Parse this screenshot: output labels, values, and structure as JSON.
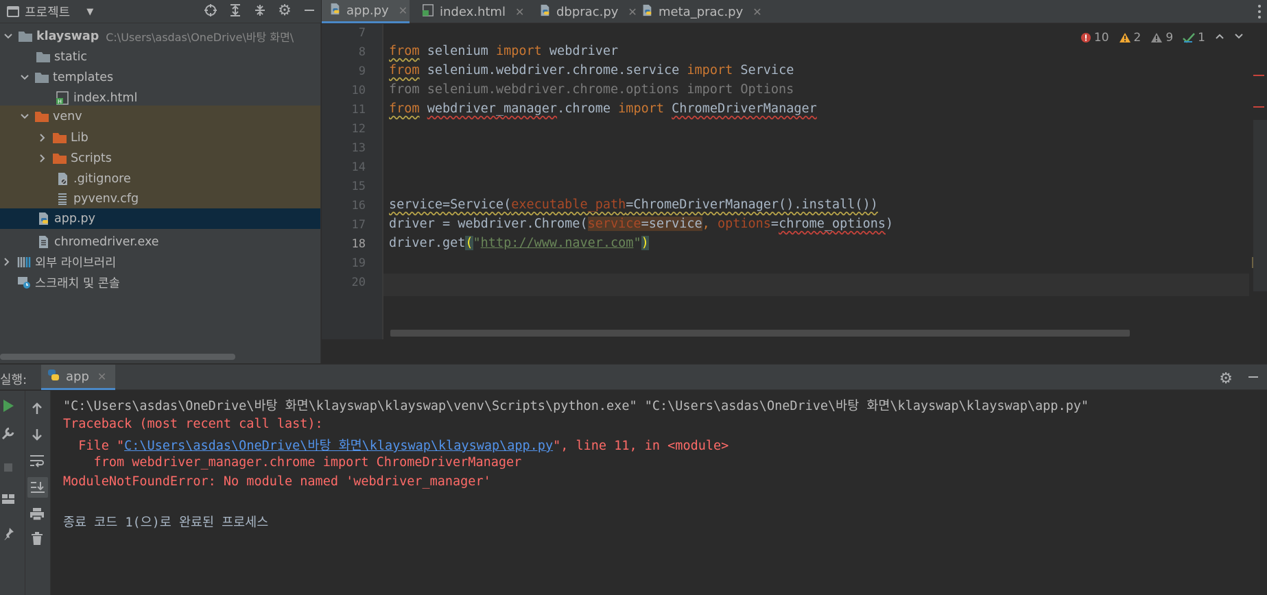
{
  "project_panel": {
    "title": "프로젝트",
    "tree": [
      {
        "label": "klayswap",
        "hint": "C:\\Users\\asdas\\OneDrive\\바탕 화면\\"
      },
      {
        "label": "static"
      },
      {
        "label": "templates"
      },
      {
        "label": "index.html"
      },
      {
        "label": "venv"
      },
      {
        "label": "Lib"
      },
      {
        "label": "Scripts"
      },
      {
        "label": ".gitignore"
      },
      {
        "label": "pyvenv.cfg"
      },
      {
        "label": "app.py"
      },
      {
        "label": "chromedriver.exe"
      },
      {
        "label": "외부 라이브러리"
      },
      {
        "label": "스크래치 및 콘솔"
      }
    ]
  },
  "tabs": [
    {
      "label": "app.py",
      "active": true
    },
    {
      "label": "index.html"
    },
    {
      "label": "dbprac.py"
    },
    {
      "label": "meta_prac.py"
    }
  ],
  "editor": {
    "line_numbers": [
      "7",
      "8",
      "9",
      "10",
      "11",
      "12",
      "13",
      "14",
      "15",
      "16",
      "17",
      "18",
      "19",
      "20"
    ],
    "current_line": "18",
    "code": {
      "l8": {
        "kw1": "from",
        "mod": "selenium",
        "kw2": "import",
        "name": "webdriver"
      },
      "l9": {
        "kw1": "from",
        "mod": "selenium.webdriver.chrome.service",
        "kw2": "import",
        "name": "Service"
      },
      "l10": {
        "text": "from selenium.webdriver.chrome.options import Options"
      },
      "l11": {
        "kw1": "from",
        "mod": "webdriver_manager",
        "mod2": ".chrome",
        "kw2": "import",
        "name": "ChromeDriverManager"
      },
      "l16": {
        "a": "service=Service(",
        "p": "executable_path",
        "b": "=ChromeDriverManager().install())"
      },
      "l17": {
        "a": "driver = webdriver.Chrome(",
        "p1": "service",
        "b": "=service",
        "c": ", ",
        "p2": "options",
        "d": "=",
        "e": "chrome_options",
        "f": ")"
      },
      "l18": {
        "a": "driver.get",
        "open": "(",
        "q1": "\"",
        "url": "http://www.naver.com",
        "q2": "\"",
        "close": ")"
      }
    },
    "inspections": {
      "errors": "10",
      "warnings": "2",
      "weak": "9",
      "typos": "1"
    }
  },
  "run_panel": {
    "label": "실행:",
    "tab": "app",
    "console": {
      "cmd": "\"C:\\Users\\asdas\\OneDrive\\바탕 화면\\klayswap\\klayswap\\venv\\Scripts\\python.exe\" \"C:\\Users\\asdas\\OneDrive\\바탕 화면\\klayswap\\klayswap\\app.py\"",
      "traceback": "Traceback (most recent call last):",
      "file_prefix": "  File \"",
      "file_link": "C:\\Users\\asdas\\OneDrive\\바탕 화면\\klayswap\\klayswap\\app.py",
      "file_suffix": "\", line 11, in <module>",
      "code_line": "    from webdriver_manager.chrome import ChromeDriverManager",
      "error": "ModuleNotFoundError: No module named 'webdriver_manager'",
      "exit": "종료 코드 1(으)로 완료된 프로세스"
    }
  },
  "colors": {
    "keyword": "#cc7832",
    "string": "#6a8759",
    "error": "#ff6b68",
    "link": "#5394ec",
    "accent": "#4a88c7"
  }
}
